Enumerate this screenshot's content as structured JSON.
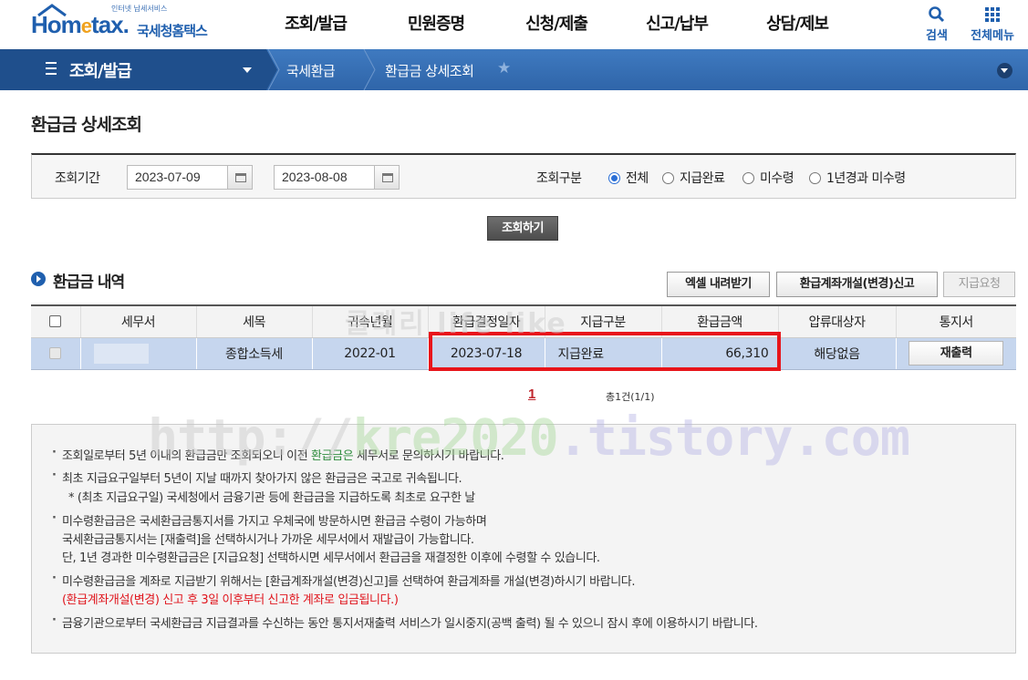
{
  "header": {
    "logo_small": "인터넷 납세서비스",
    "logo_main_a": "Hom",
    "logo_main_e": "e",
    "logo_main_b": "tax.",
    "logo_kr": "국세청홈택스",
    "gnb": [
      "조회/발급",
      "민원증명",
      "신청/제출",
      "신고/납부",
      "상담/제보"
    ],
    "search_label": "검색",
    "menu_label": "전체메뉴"
  },
  "navbar": {
    "first": "조회/발급",
    "crumbs": [
      "국세환급",
      "환급금 상세조회"
    ]
  },
  "page_title": "환급금 상세조회",
  "search": {
    "period_label": "조회기간",
    "date_from": "2023-07-09",
    "tilde": "~",
    "date_to": "2023-08-08",
    "type_label": "조회구분",
    "options": [
      "전체",
      "지급완료",
      "미수령",
      "1년경과 미수령"
    ],
    "query_button": "조회하기"
  },
  "section": {
    "title": "환급금 내역",
    "excel_button": "엑셀 내려받기",
    "account_button": "환급계좌개설(변경)신고",
    "pay_request_button": "지급요청"
  },
  "table": {
    "headers": [
      "세무서",
      "세목",
      "귀속년월",
      "환급결정일자",
      "지급구분",
      "환급금액",
      "압류대상자",
      "통지서"
    ],
    "rows": [
      {
        "tax_office": "",
        "tax_item": "종합소득세",
        "period": "2022-01",
        "decision_date": "2023-07-18",
        "pay_type": "지급완료",
        "amount": "66,310",
        "seizure": "해당없음",
        "reprint": "재출력"
      }
    ]
  },
  "pagination": {
    "current": "1",
    "total": "총1건(1/1)"
  },
  "info": {
    "l1a": "조회일로부터 5년 이내의 환급금만 조회되오니 이전 ",
    "l1b": "환급금은",
    "l1c": " 세무서로 문의하시기 바랍니다.",
    "l2": "최초 지급요구일부터 5년이 지날 때까지 찾아가지 않은 환급금은 국고로 귀속됩니다.",
    "l3": "* (최초 지급요구일) 국세청에서 금융기관 등에 환급금을 지급하도록 최초로 요구한 날",
    "l4": "미수령환급금은 국세환급금통지서를 가지고 우체국에 방문하시면 환급금 수령이 가능하며",
    "l5": "국세환급금통지서는 [재출력]을 선택하시거나 가까운 세무서에서 재발급이 가능합니다.",
    "l6": "단, 1년 경과한 미수령환급금은 [지급요청] 선택하시면 세무서에서 환급금을 재결정한 이후에 수령할 수 있습니다.",
    "l7": "미수령환급금을 계좌로 지급받기 위해서는 [환급계좌개설(변경)신고]를 선택하여 환급계좌를 개설(변경)하시기 바랍니다.",
    "l8": "(환급계좌개설(변경) 신고 후 3일 이후부터 신고한 계좌로 입금됩니다.)",
    "l9": "금융기관으로부터 국세환급금 지급결과를 수신하는 동안 통지서재출력 서비스가 일시중지(공백 출력) 될 수 있으니 잠시 후에 이용하시기 바랍니다."
  },
  "watermark": {
    "p1": "http://",
    "p2": "kre2020",
    "p3": ".tistory.com",
    "overlay": "클래리 life like"
  }
}
